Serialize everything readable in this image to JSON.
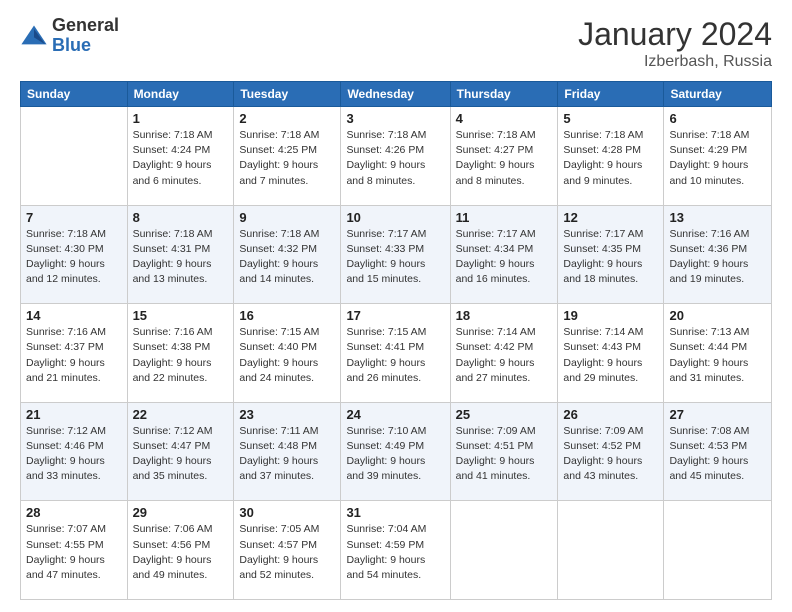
{
  "header": {
    "logo_general": "General",
    "logo_blue": "Blue",
    "month_title": "January 2024",
    "location": "Izberbash, Russia"
  },
  "days_of_week": [
    "Sunday",
    "Monday",
    "Tuesday",
    "Wednesday",
    "Thursday",
    "Friday",
    "Saturday"
  ],
  "weeks": [
    [
      {
        "day": "",
        "info": ""
      },
      {
        "day": "1",
        "info": "Sunrise: 7:18 AM\nSunset: 4:24 PM\nDaylight: 9 hours\nand 6 minutes."
      },
      {
        "day": "2",
        "info": "Sunrise: 7:18 AM\nSunset: 4:25 PM\nDaylight: 9 hours\nand 7 minutes."
      },
      {
        "day": "3",
        "info": "Sunrise: 7:18 AM\nSunset: 4:26 PM\nDaylight: 9 hours\nand 8 minutes."
      },
      {
        "day": "4",
        "info": "Sunrise: 7:18 AM\nSunset: 4:27 PM\nDaylight: 9 hours\nand 8 minutes."
      },
      {
        "day": "5",
        "info": "Sunrise: 7:18 AM\nSunset: 4:28 PM\nDaylight: 9 hours\nand 9 minutes."
      },
      {
        "day": "6",
        "info": "Sunrise: 7:18 AM\nSunset: 4:29 PM\nDaylight: 9 hours\nand 10 minutes."
      }
    ],
    [
      {
        "day": "7",
        "info": "Sunrise: 7:18 AM\nSunset: 4:30 PM\nDaylight: 9 hours\nand 12 minutes."
      },
      {
        "day": "8",
        "info": "Sunrise: 7:18 AM\nSunset: 4:31 PM\nDaylight: 9 hours\nand 13 minutes."
      },
      {
        "day": "9",
        "info": "Sunrise: 7:18 AM\nSunset: 4:32 PM\nDaylight: 9 hours\nand 14 minutes."
      },
      {
        "day": "10",
        "info": "Sunrise: 7:17 AM\nSunset: 4:33 PM\nDaylight: 9 hours\nand 15 minutes."
      },
      {
        "day": "11",
        "info": "Sunrise: 7:17 AM\nSunset: 4:34 PM\nDaylight: 9 hours\nand 16 minutes."
      },
      {
        "day": "12",
        "info": "Sunrise: 7:17 AM\nSunset: 4:35 PM\nDaylight: 9 hours\nand 18 minutes."
      },
      {
        "day": "13",
        "info": "Sunrise: 7:16 AM\nSunset: 4:36 PM\nDaylight: 9 hours\nand 19 minutes."
      }
    ],
    [
      {
        "day": "14",
        "info": "Sunrise: 7:16 AM\nSunset: 4:37 PM\nDaylight: 9 hours\nand 21 minutes."
      },
      {
        "day": "15",
        "info": "Sunrise: 7:16 AM\nSunset: 4:38 PM\nDaylight: 9 hours\nand 22 minutes."
      },
      {
        "day": "16",
        "info": "Sunrise: 7:15 AM\nSunset: 4:40 PM\nDaylight: 9 hours\nand 24 minutes."
      },
      {
        "day": "17",
        "info": "Sunrise: 7:15 AM\nSunset: 4:41 PM\nDaylight: 9 hours\nand 26 minutes."
      },
      {
        "day": "18",
        "info": "Sunrise: 7:14 AM\nSunset: 4:42 PM\nDaylight: 9 hours\nand 27 minutes."
      },
      {
        "day": "19",
        "info": "Sunrise: 7:14 AM\nSunset: 4:43 PM\nDaylight: 9 hours\nand 29 minutes."
      },
      {
        "day": "20",
        "info": "Sunrise: 7:13 AM\nSunset: 4:44 PM\nDaylight: 9 hours\nand 31 minutes."
      }
    ],
    [
      {
        "day": "21",
        "info": "Sunrise: 7:12 AM\nSunset: 4:46 PM\nDaylight: 9 hours\nand 33 minutes."
      },
      {
        "day": "22",
        "info": "Sunrise: 7:12 AM\nSunset: 4:47 PM\nDaylight: 9 hours\nand 35 minutes."
      },
      {
        "day": "23",
        "info": "Sunrise: 7:11 AM\nSunset: 4:48 PM\nDaylight: 9 hours\nand 37 minutes."
      },
      {
        "day": "24",
        "info": "Sunrise: 7:10 AM\nSunset: 4:49 PM\nDaylight: 9 hours\nand 39 minutes."
      },
      {
        "day": "25",
        "info": "Sunrise: 7:09 AM\nSunset: 4:51 PM\nDaylight: 9 hours\nand 41 minutes."
      },
      {
        "day": "26",
        "info": "Sunrise: 7:09 AM\nSunset: 4:52 PM\nDaylight: 9 hours\nand 43 minutes."
      },
      {
        "day": "27",
        "info": "Sunrise: 7:08 AM\nSunset: 4:53 PM\nDaylight: 9 hours\nand 45 minutes."
      }
    ],
    [
      {
        "day": "28",
        "info": "Sunrise: 7:07 AM\nSunset: 4:55 PM\nDaylight: 9 hours\nand 47 minutes."
      },
      {
        "day": "29",
        "info": "Sunrise: 7:06 AM\nSunset: 4:56 PM\nDaylight: 9 hours\nand 49 minutes."
      },
      {
        "day": "30",
        "info": "Sunrise: 7:05 AM\nSunset: 4:57 PM\nDaylight: 9 hours\nand 52 minutes."
      },
      {
        "day": "31",
        "info": "Sunrise: 7:04 AM\nSunset: 4:59 PM\nDaylight: 9 hours\nand 54 minutes."
      },
      {
        "day": "",
        "info": ""
      },
      {
        "day": "",
        "info": ""
      },
      {
        "day": "",
        "info": ""
      }
    ]
  ]
}
